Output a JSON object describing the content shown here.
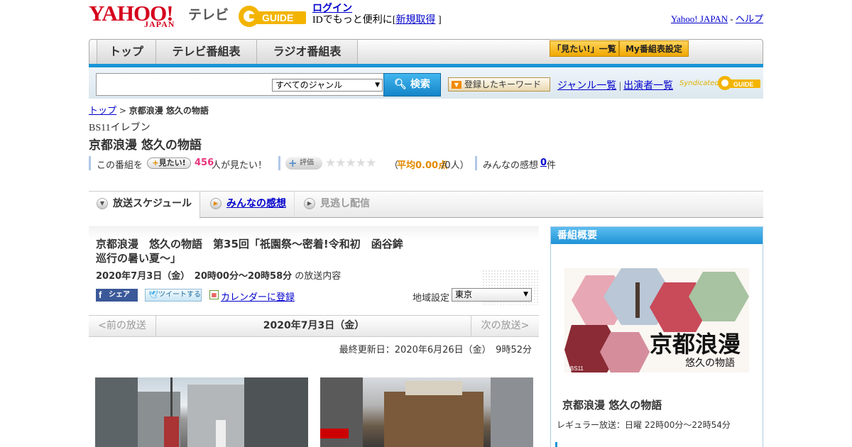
{
  "header": {
    "logo_yahoo": "YAHOO!",
    "logo_japan": "JAPAN",
    "logo_tv": "テレビ",
    "logo_gguide": "GUIDE",
    "login_link": "ログイン",
    "login_text": "IDでもっと便利に[",
    "register_link": "新規取得",
    "login_close": "]",
    "yahoo_japan_link": "Yahoo! JAPAN",
    "separator": "-",
    "help_link": "ヘルプ"
  },
  "nav": {
    "tabs": [
      "トップ",
      "テレビ番組表",
      "ラジオ番組表"
    ],
    "mitai_list": "「見たい!」一覧",
    "my_table": "My番組表設定"
  },
  "search": {
    "genre_selected": "すべてのジャンル",
    "button": "検索",
    "keyword_button": "登録したキーワード",
    "genre_list": "ジャンル一覧",
    "divider": "|",
    "performer_list": "出演者一覧",
    "syndicated": "Syndicated"
  },
  "breadcrumb": {
    "top": "トップ",
    "sep": ">",
    "current": "京都浪漫 悠久の物語"
  },
  "program": {
    "channel": "BS11イレブン",
    "title": "京都浪漫 悠久の物語",
    "kono_bangumi": "この番組を",
    "mitai_button": "見たい!",
    "mitai_count": "456",
    "mitai_suffix": "人が見たい！",
    "hyouka_button": "評価",
    "stars": "★★★★★",
    "avg_open": "（",
    "avg_score": "平均0.00点",
    "avg_count": "/0人）",
    "kanso_label": "みんなの感想",
    "kanso_count": "0",
    "kanso_suffix": "件"
  },
  "tabs": {
    "schedule": "放送スケジュール",
    "kanso": "みんなの感想",
    "minogashi": "見逃し配信"
  },
  "episode": {
    "title_line1": "京都浪漫　悠久の物語　第35回「祇園祭～密着!令和初　函谷鉾",
    "title_line2": "巡行の暑い夏～」",
    "date": "2020年7月3日（金）　20時00分～20時58分",
    "date_suffix": "の放送内容",
    "share_fb": "シェア",
    "share_tw": "ツイートする",
    "calendar": "カレンダーに登録",
    "region_label": "地域設定",
    "region_value": "東京"
  },
  "pager": {
    "prev": "<前の放送",
    "current": "2020年7月3日（金）",
    "next": "次の放送>"
  },
  "updated": "最終更新日：2020年6月26日（金）　9時52分",
  "sidebar": {
    "header": "番組概要",
    "image_logo": "京都浪漫",
    "image_sub": "悠久の物語",
    "image_credit": "©BS11",
    "program_title": "京都浪漫 悠久の物語",
    "regular": "レギュラー放送：日曜 22時00分～22時54分"
  },
  "colors": {
    "accent_blue": "#1a94d6",
    "brand_red": "#d5001c",
    "link": "#0000cc",
    "pink_count": "#e8357d",
    "orange_score": "#e28a00"
  }
}
